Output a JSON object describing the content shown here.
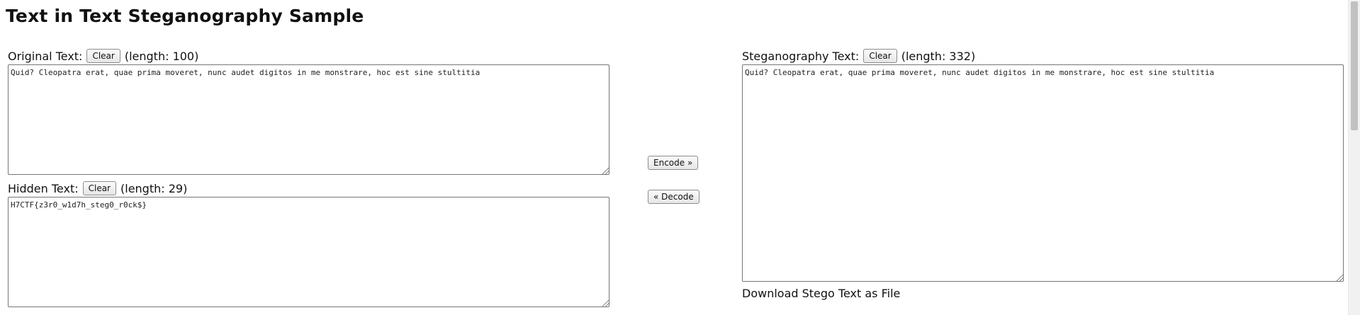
{
  "page": {
    "title": "Text in Text Steganography Sample"
  },
  "original": {
    "label": "Original Text:",
    "clear_label": "Clear",
    "length_text": "(length: 100)",
    "value": "Quid? Cleopatra erat, quae prima moveret, nunc audet digitos in me monstrare, hoc est sine stultitia"
  },
  "hidden": {
    "label": "Hidden Text:",
    "clear_label": "Clear",
    "length_text": "(length: 29)",
    "value": "H7CTF{z3r0_w1d7h_steg0_r0ck$}"
  },
  "actions": {
    "encode_label": "Encode »",
    "decode_label": "« Decode"
  },
  "stego": {
    "label": "Steganography Text:",
    "clear_label": "Clear",
    "length_text": "(length: 332)",
    "value": "Quid? Cleopatra erat, quae prima moveret, nunc audet digitos in me monstrare, hoc est sine stultitia",
    "download_label": "Download Stego Text as File"
  },
  "colors": {
    "spellcheck_underline": "#e0342a",
    "scrollbar_thumb": "#c1c1c1"
  }
}
